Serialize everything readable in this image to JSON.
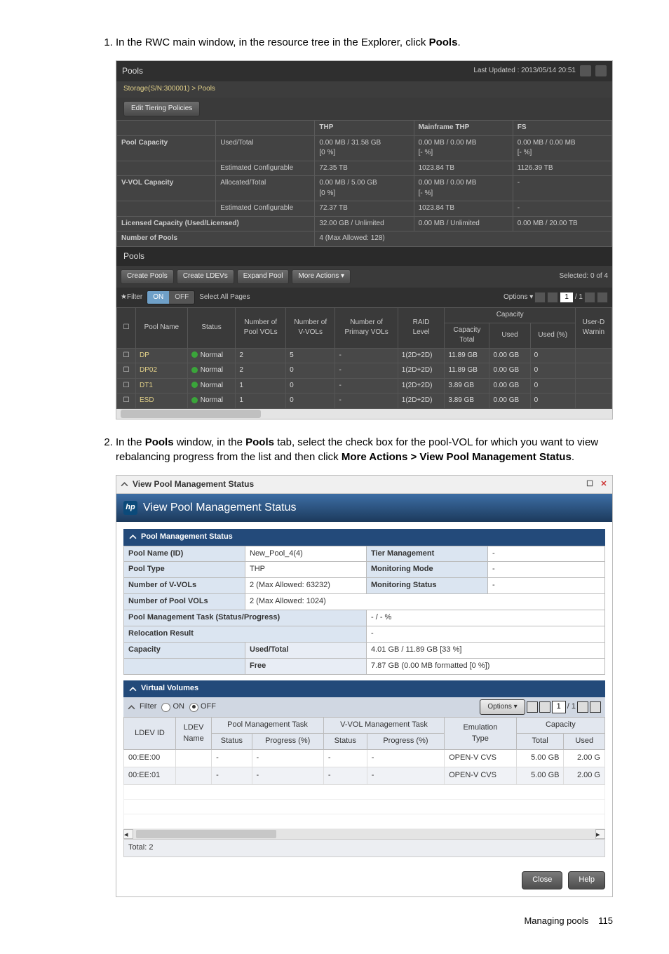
{
  "step1_pre": "In the RWC main window, in the resource tree in the Explorer, click ",
  "step1_bold": "Pools",
  "step1_post": ".",
  "step2_a": "In the ",
  "step2_b1": "Pools",
  "step2_c": " window, in the ",
  "step2_b2": "Pools",
  "step2_d": " tab, select the check box for the pool-VOL for which you want to view rebalancing progress from the list and then click ",
  "step2_b3": "More Actions > View Pool Management Status",
  "step2_e": ".",
  "s1": {
    "title": "Pools",
    "updated": "Last Updated : 2013/05/14 20:51",
    "crumb": "Storage(S/N:300001) > Pools",
    "etp": "Edit Tiering Policies",
    "hdr": {
      "thp": "THP",
      "mf": "Mainframe THP",
      "fs": "FS"
    },
    "rows": [
      {
        "k": "Pool Capacity",
        "s": "Used/Total",
        "thp": "0.00 MB / 31.58 GB\n[0 %]",
        "mf": "0.00 MB / 0.00 MB\n[- %]",
        "fs": "0.00 MB / 0.00 MB\n[- %]"
      },
      {
        "k": "",
        "s": "Estimated Configurable",
        "thp": "72.35 TB",
        "mf": "1023.84 TB",
        "fs": "1126.39 TB"
      },
      {
        "k": "V-VOL Capacity",
        "s": "Allocated/Total",
        "thp": "0.00 MB / 5.00 GB\n[0 %]",
        "mf": "0.00 MB / 0.00 MB\n[- %]",
        "fs": "-"
      },
      {
        "k": "",
        "s": "Estimated Configurable",
        "thp": "72.37 TB",
        "mf": "1023.84 TB",
        "fs": "-"
      },
      {
        "k": "Licensed Capacity (Used/Licensed)",
        "s": "",
        "thp": "32.00 GB / Unlimited",
        "mf": "0.00 MB / Unlimited",
        "fs": "0.00 MB / 20.00 TB"
      },
      {
        "k": "Number of Pools",
        "s": "",
        "thp": "4 (Max Allowed: 128)",
        "mf": "",
        "fs": ""
      }
    ],
    "sub": "Pools",
    "btn": {
      "cp": "Create Pools",
      "cl": "Create LDEVs",
      "ep": "Expand Pool",
      "ma": "More Actions"
    },
    "sel": "Selected: 0  of 4",
    "filter": "★Filter",
    "on": "ON",
    "off": "OFF",
    "sap": "Select All Pages",
    "opt": "Options",
    "page": "1",
    "pages": "/ 1",
    "h": {
      "ck": "",
      "pn": "Pool Name",
      "st": "Status",
      "npv": "Number of\nPool VOLs",
      "nvv": "Number of\nV-VOLs",
      "npr": "Number of\nPrimary VOLs",
      "raid": "RAID\nLevel",
      "ct": "Capacity\nTotal",
      "cu": "Used",
      "cup": "Used (%)",
      "w": "User-D\nWarnin"
    },
    "g": [
      {
        "n": "DP",
        "s": "Normal",
        "pv": "2",
        "vv": "5",
        "pr": "-",
        "r": "1(2D+2D)",
        "t": "11.89 GB",
        "u": "0.00 GB",
        "p": "0",
        "w": ""
      },
      {
        "n": "DP02",
        "s": "Normal",
        "pv": "2",
        "vv": "0",
        "pr": "-",
        "r": "1(2D+2D)",
        "t": "11.89 GB",
        "u": "0.00 GB",
        "p": "0",
        "w": ""
      },
      {
        "n": "DT1",
        "s": "Normal",
        "pv": "1",
        "vv": "0",
        "pr": "-",
        "r": "1(2D+2D)",
        "t": "3.89 GB",
        "u": "0.00 GB",
        "p": "0",
        "w": ""
      },
      {
        "n": "ESD",
        "s": "Normal",
        "pv": "1",
        "vv": "0",
        "pr": "-",
        "r": "1(2D+2D)",
        "t": "3.89 GB",
        "u": "0.00 GB",
        "p": "0",
        "w": ""
      }
    ]
  },
  "s2": {
    "wtitle": "View Pool Management Status",
    "banner": "View Pool Management Status",
    "sec1": "Pool Management Status",
    "meta": [
      {
        "k": "Pool Name (ID)",
        "v": "New_Pool_4(4)",
        "k2": "Tier Management",
        "v2": "-"
      },
      {
        "k": "Pool Type",
        "v": "THP",
        "k2": "Monitoring Mode",
        "v2": "-"
      },
      {
        "k": "Number of V-VOLs",
        "v": "2 (Max Allowed: 63232)",
        "k2": "Monitoring Status",
        "v2": "-"
      },
      {
        "k": "Number of Pool VOLs",
        "v": "2 (Max Allowed: 1024)",
        "k2": "",
        "v2": ""
      },
      {
        "k": "Pool Management Task (Status/Progress)",
        "v": "",
        "k2": "",
        "v2": "- / - %"
      },
      {
        "k": "Relocation Result",
        "v": "",
        "k2": "",
        "v2": "-"
      },
      {
        "k": "Capacity",
        "v": "Used/Total",
        "k2": "",
        "v2": "4.01 GB / 11.89 GB [33 %]"
      },
      {
        "k": "",
        "v": "Free",
        "k2": "",
        "v2": "7.87 GB (0.00 MB formatted [0 %])"
      }
    ],
    "sec2": "Virtual Volumes",
    "fbar": {
      "f": "Filter",
      "on": "ON",
      "off": "OFF",
      "opt": "Options",
      "page": "1",
      "pages": "/ 1"
    },
    "vh": {
      "ldev": "LDEV ID",
      "lname": "LDEV\nName",
      "pmt": "Pool Management Task",
      "vvm": "V-VOL Management Task",
      "st": "Status",
      "pr": "Progress (%)",
      "em": "Emulation\nType",
      "cap": "Capacity",
      "tot": "Total",
      "used": "Used"
    },
    "vrows": [
      {
        "id": "00:EE:00",
        "nm": "",
        "ps": "-",
        "pp": "-",
        "vs": "-",
        "vp": "-",
        "em": "OPEN-V CVS",
        "t": "5.00 GB",
        "u": "2.00 G"
      },
      {
        "id": "00:EE:01",
        "nm": "",
        "ps": "-",
        "pp": "-",
        "vs": "-",
        "vp": "-",
        "em": "OPEN-V CVS",
        "t": "5.00 GB",
        "u": "2.00 G"
      }
    ],
    "total": "Total: 2",
    "close": "Close",
    "help": "Help"
  },
  "footer": {
    "left": "Managing pools",
    "right": "115"
  }
}
